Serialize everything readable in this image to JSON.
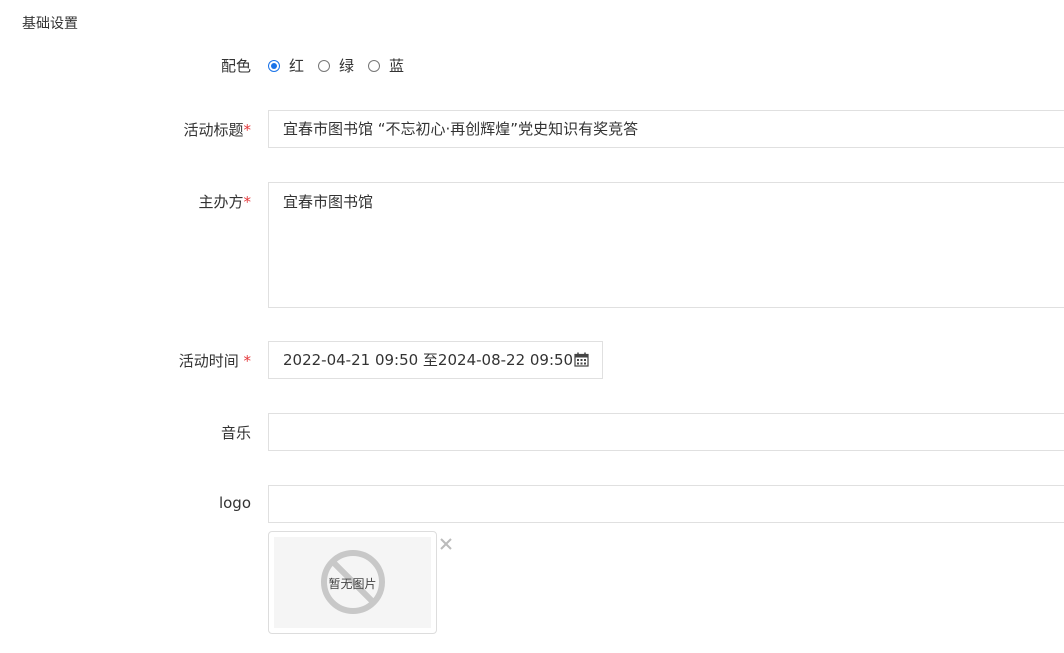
{
  "section": {
    "title": "基础设置"
  },
  "color_scheme": {
    "label": "配色",
    "options": [
      "红",
      "绿",
      "蓝"
    ],
    "selected": "红"
  },
  "title_field": {
    "label": "活动标题",
    "required_mark": "*",
    "value": "宜春市图书馆 “不忘初心·再创辉煌”党史知识有奖竞答"
  },
  "organizer_field": {
    "label": "主办方",
    "required_mark": "*",
    "value": "宜春市图书馆"
  },
  "time_field": {
    "label": "活动时间 ",
    "required_mark": "*",
    "value": "2022-04-21 09:50 至2024-08-22 09:50"
  },
  "music_field": {
    "label": "音乐",
    "value": ""
  },
  "logo_field": {
    "label": "logo",
    "value": "",
    "placeholder_text": "暂无图片"
  },
  "colors": {
    "accent": "#1a73e8",
    "required": "#e4393c",
    "border": "#e0e0e0"
  },
  "icons": [
    "calendar-icon",
    "close-icon",
    "no-image-icon"
  ]
}
